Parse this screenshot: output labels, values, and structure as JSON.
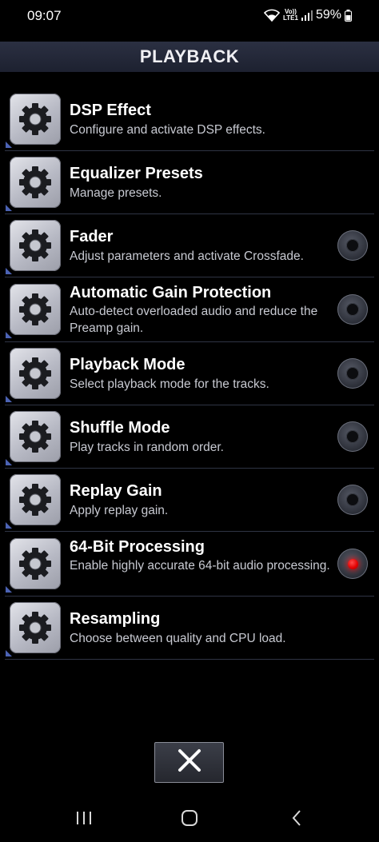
{
  "status_bar": {
    "time": "09:07",
    "network_label_top": "Vo))",
    "network_label_bottom": "LTE1",
    "battery_percent": "59%",
    "icons": [
      "wifi-icon",
      "volte-icon",
      "signal-icon",
      "battery-icon"
    ]
  },
  "header": {
    "title": "PLAYBACK"
  },
  "settings": [
    {
      "title": "DSP Effect",
      "subtitle": "Configure and activate DSP effects.",
      "toggle": null
    },
    {
      "title": "Equalizer Presets",
      "subtitle": "Manage presets.",
      "toggle": null
    },
    {
      "title": "Fader",
      "subtitle": "Adjust parameters and activate Crossfade.",
      "toggle": false
    },
    {
      "title": "Automatic Gain Protection",
      "subtitle": "Auto-detect overloaded audio and reduce the Preamp gain.",
      "toggle": false
    },
    {
      "title": "Playback Mode",
      "subtitle": "Select playback mode for the tracks.",
      "toggle": false
    },
    {
      "title": "Shuffle Mode",
      "subtitle": "Play tracks in random order.",
      "toggle": false
    },
    {
      "title": "Replay Gain",
      "subtitle": "Apply replay gain.",
      "toggle": false
    },
    {
      "title": "64-Bit Processing",
      "subtitle": "Enable highly accurate 64-bit audio processing.",
      "toggle": true
    },
    {
      "title": "Resampling",
      "subtitle": "Choose between quality and CPU load.",
      "toggle": null
    }
  ],
  "close_button": {
    "icon": "close-icon"
  },
  "nav_bar": {
    "icons": [
      "recent-apps-icon",
      "home-icon",
      "back-icon"
    ]
  },
  "colors": {
    "background": "#000000",
    "header": "#23283a",
    "accent_on": "#ff0000",
    "divider": "#2f3444",
    "corner_marker": "#4c63b4"
  }
}
